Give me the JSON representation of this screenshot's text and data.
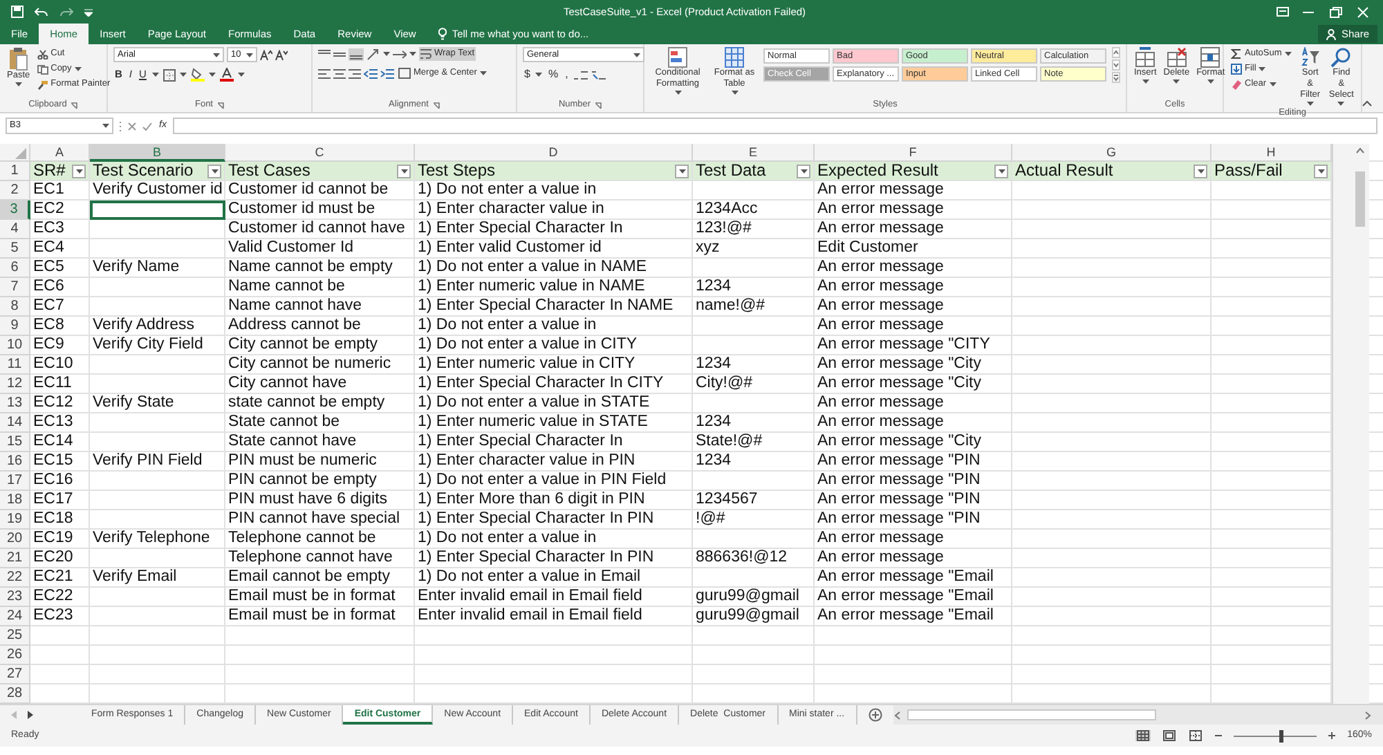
{
  "window": {
    "title": "TestCaseSuite_v1 - Excel (Product Activation Failed)"
  },
  "ribbon_tabs": [
    {
      "label": "File",
      "selected": false
    },
    {
      "label": "Home",
      "selected": true
    },
    {
      "label": "Insert",
      "selected": false
    },
    {
      "label": "Page Layout",
      "selected": false
    },
    {
      "label": "Formulas",
      "selected": false
    },
    {
      "label": "Data",
      "selected": false
    },
    {
      "label": "Review",
      "selected": false
    },
    {
      "label": "View",
      "selected": false
    }
  ],
  "tell_me": "Tell me what you want to do...",
  "share": "Share",
  "ribbon": {
    "clipboard": {
      "label": "Clipboard",
      "paste": "Paste",
      "items": [
        "Cut",
        "Copy",
        "Format Painter"
      ]
    },
    "font": {
      "label": "Font",
      "font_name": "Arial",
      "font_size": "10",
      "format_buttons": [
        "B",
        "I",
        "U"
      ]
    },
    "alignment": {
      "label": "Alignment",
      "bottom_align_on": true,
      "wrap_text": {
        "label": "Wrap Text",
        "on": true
      },
      "merge": "Merge & Center"
    },
    "number": {
      "label": "Number",
      "format": "General",
      "symbols": [
        "$",
        "%",
        ","
      ]
    },
    "styles": {
      "label": "Styles",
      "conditional": "Conditional Formatting",
      "format_table": "Format as Table",
      "cell_styles": [
        {
          "label": "Normal",
          "color": "#ffffff"
        },
        {
          "label": "Bad",
          "color": "#ffc7ce"
        },
        {
          "label": "Good",
          "color": "#c6efce"
        },
        {
          "label": "Neutral",
          "color": "#ffeb9c"
        },
        {
          "label": "Calculation",
          "color": "#f2f2f2"
        },
        {
          "label": "Check Cell",
          "color": "#a5a5a5"
        },
        {
          "label": "Explanatory ...",
          "color": "#ffffff"
        },
        {
          "label": "Input",
          "color": "#ffcc99"
        },
        {
          "label": "Linked Cell",
          "color": "#ffffff"
        },
        {
          "label": "Note",
          "color": "#ffffcc"
        }
      ]
    },
    "cells": {
      "label": "Cells",
      "buttons": [
        "Insert",
        "Delete",
        "Format"
      ]
    },
    "editing": {
      "label": "Editing",
      "items": [
        "AutoSum",
        "Fill",
        "Clear"
      ],
      "buttons": [
        "Sort & Filter",
        "Find & Select"
      ]
    }
  },
  "formula_bar": {
    "name_box": "B3",
    "function_button": "fx"
  },
  "sheet": {
    "columns": [
      {
        "letter": "A",
        "heading": "SR#",
        "selected": false
      },
      {
        "letter": "B",
        "heading": "Test Scenario",
        "selected": true
      },
      {
        "letter": "C",
        "heading": "Test Cases",
        "selected": false
      },
      {
        "letter": "D",
        "heading": "Test Steps",
        "selected": false
      },
      {
        "letter": "E",
        "heading": "Test Data",
        "selected": false
      },
      {
        "letter": "F",
        "heading": "Expected Result",
        "selected": false
      },
      {
        "letter": "G",
        "heading": "Actual Result",
        "selected": false
      },
      {
        "letter": "H",
        "heading": "Pass/Fail",
        "selected": false
      }
    ],
    "header_row_number": "1",
    "rows": [
      {
        "number": "2",
        "selected": false,
        "cells": [
          "EC1",
          "Verify Customer id",
          "Customer id cannot be",
          "1) Do not enter a value in",
          null,
          "An error message"
        ]
      },
      {
        "number": "3",
        "selected": true,
        "cells": [
          "EC2",
          null,
          "Customer id must be",
          "1) Enter character value in",
          "1234Acc",
          "An error message"
        ]
      },
      {
        "number": "4",
        "selected": false,
        "cells": [
          "EC3",
          null,
          "Customer id cannot have",
          "1) Enter Special Character In",
          "123!@#",
          "An error message"
        ]
      },
      {
        "number": "5",
        "selected": false,
        "cells": [
          "EC4",
          null,
          "Valid Customer Id",
          "1) Enter valid Customer id",
          "xyz",
          "Edit Customer"
        ]
      },
      {
        "number": "6",
        "selected": false,
        "cells": [
          "EC5",
          "Verify Name",
          "Name cannot be empty",
          "1) Do not enter a value in NAME",
          null,
          "An error message"
        ]
      },
      {
        "number": "7",
        "selected": false,
        "cells": [
          "EC6",
          null,
          "Name cannot be",
          "1) Enter numeric value in NAME",
          "1234",
          "An error message"
        ]
      },
      {
        "number": "8",
        "selected": false,
        "cells": [
          "EC7",
          null,
          "Name cannot have",
          "1) Enter Special Character In NAME",
          "name!@#",
          "An error message"
        ]
      },
      {
        "number": "9",
        "selected": false,
        "cells": [
          "EC8",
          "Verify Address",
          "Address cannot be",
          "1) Do not enter a value in",
          null,
          "An error message"
        ]
      },
      {
        "number": "10",
        "selected": false,
        "cells": [
          "EC9",
          "Verify City Field",
          "City cannot be empty",
          "1) Do not enter a value in CITY",
          null,
          "An error message \"CITY"
        ]
      },
      {
        "number": "11",
        "selected": false,
        "cells": [
          "EC10",
          null,
          "City cannot be numeric",
          "1) Enter numeric value in CITY",
          "1234",
          "An error message \"City"
        ]
      },
      {
        "number": "12",
        "selected": false,
        "cells": [
          "EC11",
          null,
          "City cannot have",
          "1) Enter Special Character In CITY",
          "City!@#",
          "An error message \"City"
        ]
      },
      {
        "number": "13",
        "selected": false,
        "cells": [
          "EC12",
          "Verify State",
          "state cannot be empty",
          "1) Do not enter a value in STATE",
          null,
          "An error message"
        ]
      },
      {
        "number": "14",
        "selected": false,
        "cells": [
          "EC13",
          null,
          "State cannot be",
          "1) Enter numeric value in STATE",
          "1234",
          "An error message"
        ]
      },
      {
        "number": "15",
        "selected": false,
        "cells": [
          "EC14",
          null,
          "State cannot have",
          "1) Enter Special Character In",
          "State!@#",
          "An error message \"City"
        ]
      },
      {
        "number": "16",
        "selected": false,
        "cells": [
          "EC15",
          "Verify PIN Field",
          "PIN must be numeric",
          "1) Enter character value in PIN",
          "1234",
          "An error message \"PIN"
        ]
      },
      {
        "number": "17",
        "selected": false,
        "cells": [
          "EC16",
          null,
          "PIN cannot be empty",
          "1) Do not enter a value in PIN Field",
          null,
          "An error message \"PIN"
        ]
      },
      {
        "number": "18",
        "selected": false,
        "cells": [
          "EC17",
          null,
          "PIN must have 6 digits",
          "1) Enter More than 6 digit in PIN",
          "1234567",
          "An error message \"PIN"
        ]
      },
      {
        "number": "19",
        "selected": false,
        "cells": [
          "EC18",
          null,
          "PIN cannot have special",
          "1) Enter Special Character In PIN",
          "!@#",
          "An error message \"PIN"
        ]
      },
      {
        "number": "20",
        "selected": false,
        "cells": [
          "EC19",
          "Verify Telephone",
          "Telephone cannot be",
          "1) Do not enter a value in",
          null,
          "An error message"
        ]
      },
      {
        "number": "21",
        "selected": false,
        "cells": [
          "EC20",
          null,
          "Telephone cannot have",
          "1) Enter Special Character In PIN",
          "886636!@12",
          "An error message"
        ]
      },
      {
        "number": "22",
        "selected": false,
        "cells": [
          "EC21",
          "Verify Email",
          "Email cannot be empty",
          "1) Do not enter a value in Email",
          null,
          "An error message \"Email"
        ]
      },
      {
        "number": "23",
        "selected": false,
        "cells": [
          "EC22",
          null,
          "Email must be in format",
          "Enter invalid email in Email field",
          "guru99@gmail",
          "An error message \"Email"
        ]
      },
      {
        "number": "24",
        "selected": false,
        "cells": [
          "EC23",
          null,
          "Email must be in format",
          "Enter invalid email in Email field",
          "guru99@gmail",
          "An error message \"Email"
        ]
      },
      {
        "number": "25",
        "selected": false
      },
      {
        "number": "26",
        "selected": false
      },
      {
        "number": "27",
        "selected": false
      },
      {
        "number": "28",
        "selected": false
      }
    ]
  },
  "sheet_tabs": [
    {
      "label": "Form Responses 1",
      "selected": false
    },
    {
      "label": "Changelog",
      "selected": false
    },
    {
      "label": "New Customer",
      "selected": false
    },
    {
      "label": "Edit Customer",
      "selected": true
    },
    {
      "label": "New Account",
      "selected": false
    },
    {
      "label": "Edit Account",
      "selected": false
    },
    {
      "label": "Delete Account",
      "selected": false
    },
    {
      "label": "Delete  Customer",
      "selected": false
    },
    {
      "label": "Mini stater ...",
      "selected": false
    }
  ],
  "status_bar": {
    "status": "Ready",
    "views": [
      {
        "selected": true
      },
      {
        "selected": false
      },
      {
        "selected": false
      }
    ],
    "zoom": {
      "level": 0.57,
      "reading": "160%"
    }
  }
}
